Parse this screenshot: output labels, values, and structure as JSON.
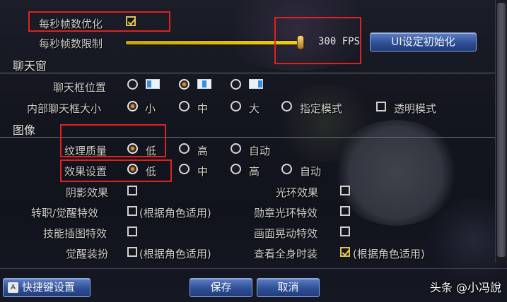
{
  "fps": {
    "optimize_label": "每秒帧数优化",
    "optimize_checked": true,
    "limit_label": "每秒帧数限制",
    "limit_value_text": "300 FPS",
    "limit_fraction": 0.98
  },
  "ui_reset_button": "UI设定初始化",
  "chat": {
    "section": "聊天窗",
    "position_label": "聊天框位置",
    "inner_size_label": "内部聊天框大小",
    "sizes": [
      "小",
      "中",
      "大",
      "指定模式"
    ],
    "selected_size": "小",
    "transparent_label": "透明模式"
  },
  "graphics": {
    "section": "图像",
    "texture_label": "纹理质量",
    "texture_options": [
      "低",
      "高",
      "自动"
    ],
    "texture_selected": "低",
    "effect_label": "效果设置",
    "effect_options": [
      "低",
      "中",
      "高",
      "自动"
    ],
    "effect_selected": "低",
    "shadow_label": "阴影效果",
    "halo_label": "光环效果",
    "awaken_effect_label": "转职/觉醒特效",
    "awaken_effect_note": "(根据角色适用)",
    "medal_label": "勋章光环特效",
    "skill_art_label": "技能插图特效",
    "screen_shake_label": "画面晃动特效",
    "awaken_outfit_label": "觉醒装扮",
    "awaken_outfit_note": "(根据角色适用)",
    "full_costume_label": "查看全身时装",
    "full_costume_note": "(根据角色适用)",
    "full_costume_checked": true
  },
  "footer": {
    "shortcut_key": "A",
    "shortcut_label": "快捷键设置",
    "save": "保存",
    "cancel": "取消"
  },
  "watermark": "头条 @小冯說"
}
